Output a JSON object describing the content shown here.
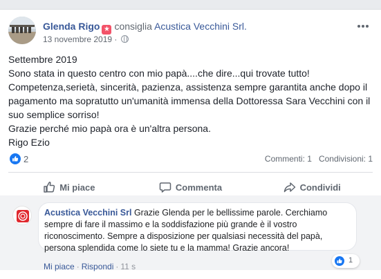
{
  "post": {
    "author": "Glenda Rigo",
    "verb": "consiglia",
    "page": "Acustica Vecchini Srl.",
    "date": "13 novembre 2019",
    "dot": "·",
    "more_icon": "more-dots-icon",
    "body_lines": [
      "Settembre 2019",
      "Sono stata in questo centro con mio papà....che dire...qui trovate tutto!",
      "Competenza,serietà, sincerità, pazienza, assistenza sempre garantita anche dopo il",
      "pagamento ma sopratutto un'umanità immensa della Dottoressa Sara Vecchini con il",
      "suo semplice sorriso!",
      "Grazie perché mio papà ora è un'altra persona.",
      "Rigo Ezio"
    ]
  },
  "stats": {
    "likes": "2",
    "comments": "Commenti: 1",
    "shares": "Condivisioni: 1"
  },
  "actions": {
    "like": "Mi piace",
    "comment": "Commenta",
    "share": "Condividi"
  },
  "comment": {
    "author": "Acustica Vecchini Srl",
    "text_lines": [
      "Grazie Glenda per le bellissime parole. Cerchiamo",
      "sempre di fare il massimo e la soddisfazione più grande è il vostro",
      "riconoscimento.  Sempre a disposizione per qualsiasi necessità del papà,",
      "persona splendida come lo siete tu e la mamma! Grazie ancora!"
    ],
    "like_label": "Mi piace",
    "reply_label": "Rispondi",
    "time": "11 s",
    "dot": "·",
    "reaction_count": "1"
  },
  "colors": {
    "link": "#385898",
    "like_blue": "#1877f2",
    "brand_red": "#e0282e"
  }
}
